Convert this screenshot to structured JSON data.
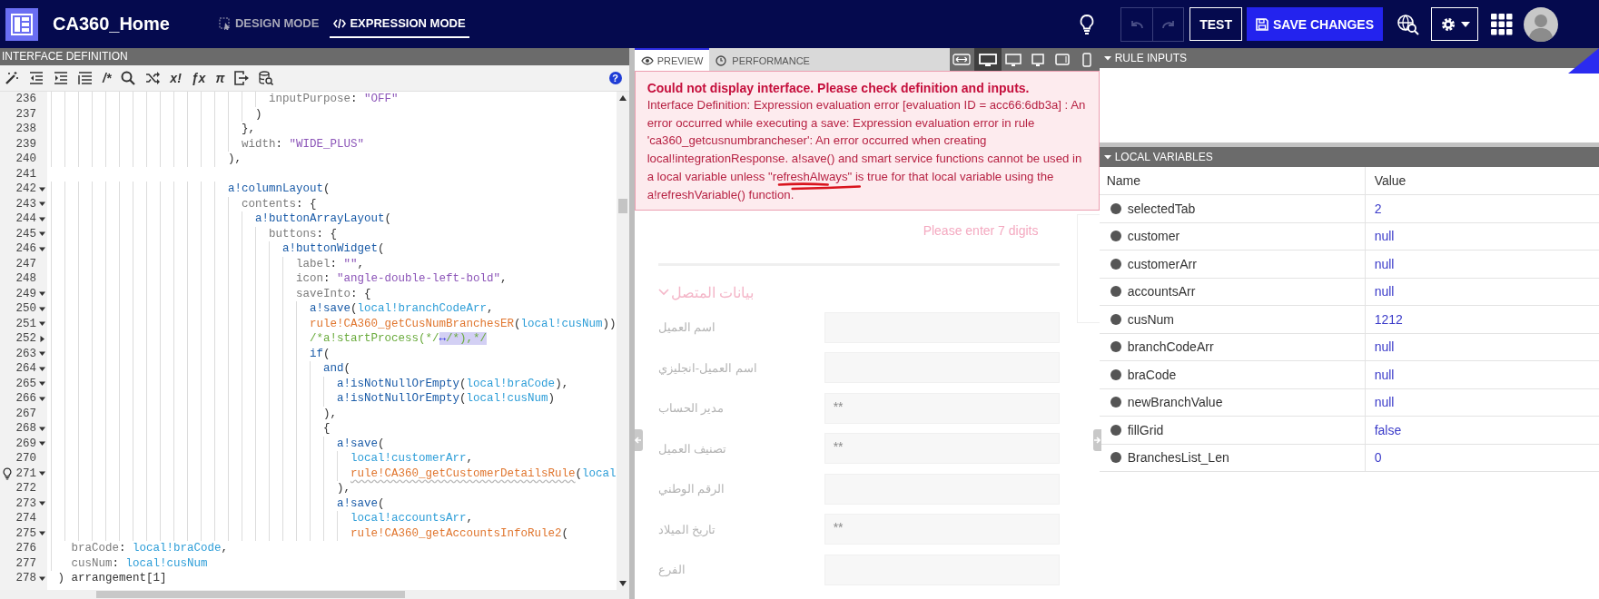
{
  "header": {
    "app_title": "CA360_Home",
    "modes": [
      {
        "label": "DESIGN MODE",
        "selected": false
      },
      {
        "label": "EXPRESSION MODE",
        "selected": true
      }
    ],
    "undo": {
      "disabled": true
    },
    "redo": {
      "disabled": true
    },
    "test_label": "TEST",
    "save_label": "SAVE CHANGES"
  },
  "editor": {
    "title": "INTERFACE DEFINITION",
    "toolbar_glyphs": [
      "/*",
      "x!",
      "ƒx",
      "π"
    ],
    "help": "?",
    "lines": [
      {
        "number": "236",
        "tokens": [
          {
            "kind": "key",
            "text": "                                inputPurpose"
          },
          {
            "kind": "punct",
            "text": ": "
          },
          {
            "kind": "string",
            "text": "\"OFF\""
          }
        ]
      },
      {
        "number": "237",
        "tokens": [
          {
            "kind": "punct",
            "text": "                              )"
          }
        ]
      },
      {
        "number": "238",
        "tokens": [
          {
            "kind": "punct",
            "text": "                            },"
          }
        ]
      },
      {
        "number": "239",
        "tokens": [
          {
            "kind": "key",
            "text": "                            width"
          },
          {
            "kind": "punct",
            "text": ": "
          },
          {
            "kind": "string",
            "text": "\"WIDE_PLUS\""
          }
        ]
      },
      {
        "number": "240",
        "tokens": [
          {
            "kind": "punct",
            "text": "                          ),"
          }
        ]
      },
      {
        "number": "241"
      },
      {
        "number": "242",
        "collapsed": false,
        "tokens": [
          {
            "kind": "func",
            "text": "                          a!columnLayout"
          },
          {
            "kind": "punct",
            "text": "("
          }
        ]
      },
      {
        "number": "243",
        "collapsed": false,
        "tokens": [
          {
            "kind": "key",
            "text": "                            contents"
          },
          {
            "kind": "punct",
            "text": ": {"
          }
        ]
      },
      {
        "number": "244",
        "collapsed": false,
        "tokens": [
          {
            "kind": "func",
            "text": "                              a!buttonArrayLayout"
          },
          {
            "kind": "punct",
            "text": "("
          }
        ]
      },
      {
        "number": "245",
        "collapsed": false,
        "tokens": [
          {
            "kind": "key",
            "text": "                                buttons"
          },
          {
            "kind": "punct",
            "text": ": {"
          }
        ]
      },
      {
        "number": "246",
        "collapsed": false,
        "tokens": [
          {
            "kind": "func",
            "text": "                                  a!buttonWidget"
          },
          {
            "kind": "punct",
            "text": "("
          }
        ]
      },
      {
        "number": "247",
        "tokens": [
          {
            "kind": "key",
            "text": "                                    label"
          },
          {
            "kind": "punct",
            "text": ": "
          },
          {
            "kind": "string",
            "text": "\"\""
          },
          {
            "kind": "punct",
            "text": ","
          }
        ]
      },
      {
        "number": "248",
        "tokens": [
          {
            "kind": "key",
            "text": "                                    icon"
          },
          {
            "kind": "punct",
            "text": ": "
          },
          {
            "kind": "string",
            "text": "\"angle-double-left-bold\""
          },
          {
            "kind": "punct",
            "text": ","
          }
        ]
      },
      {
        "number": "249",
        "collapsed": false,
        "tokens": [
          {
            "kind": "key",
            "text": "                                    saveInto"
          },
          {
            "kind": "punct",
            "text": ": {"
          }
        ]
      },
      {
        "number": "250",
        "collapsed": false,
        "tokens": [
          {
            "kind": "func",
            "text": "                                      a!save"
          },
          {
            "kind": "punct",
            "text": "("
          },
          {
            "kind": "local",
            "text": "local!branchCodeArr"
          },
          {
            "kind": "punct",
            "text": ","
          }
        ]
      },
      {
        "number": "251",
        "collapsed": false,
        "tokens": [
          {
            "kind": "rule",
            "text": "                                      rule!CA360_getCusNumBranchesER"
          },
          {
            "kind": "punct",
            "text": "("
          },
          {
            "kind": "local",
            "text": "local!cusNum"
          },
          {
            "kind": "punct",
            "text": "))"
          }
        ]
      },
      {
        "number": "252",
        "collapsed": true,
        "tokens": [
          {
            "kind": "comment",
            "text": "                                      /*a!startProcess(*/"
          },
          {
            "kind": "fold",
            "text": "↔",
            "highlighted": true
          },
          {
            "kind": "comment",
            "text": "/*),*/",
            "highlighted": true
          }
        ]
      },
      {
        "number": "263",
        "collapsed": false,
        "tokens": [
          {
            "kind": "func",
            "text": "                                      if"
          },
          {
            "kind": "punct",
            "text": "("
          }
        ]
      },
      {
        "number": "264",
        "collapsed": false,
        "tokens": [
          {
            "kind": "func",
            "text": "                                        and"
          },
          {
            "kind": "punct",
            "text": "("
          }
        ]
      },
      {
        "number": "265",
        "collapsed": false,
        "tokens": [
          {
            "kind": "func",
            "text": "                                          a!isNotNullOrEmpty"
          },
          {
            "kind": "punct",
            "text": "("
          },
          {
            "kind": "local",
            "text": "local!braCode"
          },
          {
            "kind": "punct",
            "text": "),"
          }
        ]
      },
      {
        "number": "266",
        "collapsed": false,
        "tokens": [
          {
            "kind": "func",
            "text": "                                          a!isNotNullOrEmpty"
          },
          {
            "kind": "punct",
            "text": "("
          },
          {
            "kind": "local",
            "text": "local!cusNum"
          },
          {
            "kind": "punct",
            "text": ")"
          }
        ]
      },
      {
        "number": "267",
        "tokens": [
          {
            "kind": "punct",
            "text": "                                        ),"
          }
        ]
      },
      {
        "number": "268",
        "collapsed": false,
        "tokens": [
          {
            "kind": "punct",
            "text": "                                        {"
          }
        ]
      },
      {
        "number": "269",
        "collapsed": false,
        "tokens": [
          {
            "kind": "func",
            "text": "                                          a!save"
          },
          {
            "kind": "punct",
            "text": "("
          }
        ]
      },
      {
        "number": "270",
        "tokens": [
          {
            "kind": "local",
            "text": "                                            local!customerArr"
          },
          {
            "kind": "punct",
            "text": ","
          }
        ]
      },
      {
        "number": "271",
        "collapsed": false,
        "hint": true,
        "tokens": [
          {
            "kind": "rule",
            "text": "                                            rule!CA360_getCustomerDetailsRule",
            "warning": true
          },
          {
            "kind": "punct",
            "text": "("
          },
          {
            "kind": "local",
            "text": "local"
          }
        ]
      },
      {
        "number": "272",
        "tokens": [
          {
            "kind": "punct",
            "text": "                                          ),"
          }
        ]
      },
      {
        "number": "273",
        "collapsed": false,
        "tokens": [
          {
            "kind": "func",
            "text": "                                          a!save"
          },
          {
            "kind": "punct",
            "text": "("
          }
        ]
      },
      {
        "number": "274",
        "tokens": [
          {
            "kind": "local",
            "text": "                                            local!accountsArr"
          },
          {
            "kind": "punct",
            "text": ","
          }
        ]
      },
      {
        "number": "275",
        "collapsed": false,
        "tokens": [
          {
            "kind": "rule",
            "text": "                                            rule!CA360_getAccountsInfoRule2"
          },
          {
            "kind": "punct",
            "text": "("
          }
        ]
      },
      {
        "number": "276",
        "tokens": [
          {
            "kind": "key",
            "text": "   braCode"
          },
          {
            "kind": "punct",
            "text": ": "
          },
          {
            "kind": "local",
            "text": "local!braCode"
          },
          {
            "kind": "punct",
            "text": ","
          }
        ]
      },
      {
        "number": "277",
        "tokens": [
          {
            "kind": "key",
            "text": "   cusNum"
          },
          {
            "kind": "punct",
            "text": ": "
          },
          {
            "kind": "local",
            "text": "local!cusNum"
          }
        ]
      },
      {
        "number": "278",
        "collapsed": false,
        "tokens": [
          {
            "kind": "punct",
            "text": " ) "
          },
          {
            "kind": "punct",
            "text": "arrangement[1]"
          }
        ]
      }
    ]
  },
  "preview": {
    "tabs": [
      {
        "label": "PREVIEW",
        "selected": true
      },
      {
        "label": "PERFORMANCE",
        "selected": false
      }
    ],
    "devices": [
      {
        "selected": false
      },
      {
        "selected": true
      },
      {
        "selected": false
      },
      {
        "selected": false
      },
      {
        "selected": false
      },
      {
        "selected": false
      }
    ],
    "error": {
      "title": "Could not display interface. Please check definition and inputs.",
      "body": [
        {
          "text": "Interface Definition: Expression evaluation error [evaluation ID = acc66:6db3a] : An error occurred while executing a save: Expression evaluation error in rule 'ca360_getcusnumbrancheser': An error occurred when creating local!integrationResponse. a!save() and smart service functions cannot be used in a local variable unless \""
        },
        {
          "text": "refreshAlways",
          "underlined": true
        },
        {
          "text": "\" is true for that local variable using the a!refreshVariable() function."
        }
      ]
    },
    "form": {
      "hint": "Please enter 7 digits",
      "section": {
        "title": "بيانات المتصل",
        "expanded": true
      },
      "fields": [
        {
          "label": "اسم العميل"
        },
        {
          "label": "اسم العميل-انجليزي"
        },
        {
          "label": "مدير الحساب",
          "value": "**"
        },
        {
          "label": "تصنيف العميل",
          "value": "**"
        },
        {
          "label": "الرقم الوطني"
        },
        {
          "label": "تاريخ الميلاد",
          "value": "**"
        },
        {
          "label": "الفرع"
        }
      ]
    }
  },
  "rule_inputs": {
    "title": "RULE INPUTS",
    "expanded": true
  },
  "local_variables": {
    "title": "LOCAL VARIABLES",
    "expanded": true,
    "columns": [
      "Name",
      "Value"
    ],
    "rows": [
      {
        "name": "selectedTab",
        "value": "2"
      },
      {
        "name": "customer",
        "value": "null"
      },
      {
        "name": "customerArr",
        "value": "null"
      },
      {
        "name": "accountsArr",
        "value": "null"
      },
      {
        "name": "cusNum",
        "value": "1212"
      },
      {
        "name": "branchCodeArr",
        "value": "null"
      },
      {
        "name": "braCode",
        "value": "null"
      },
      {
        "name": "newBranchValue",
        "value": "null"
      },
      {
        "name": "fillGrid",
        "value": "false"
      },
      {
        "name": "BranchesList_Len",
        "value": "0"
      }
    ]
  }
}
